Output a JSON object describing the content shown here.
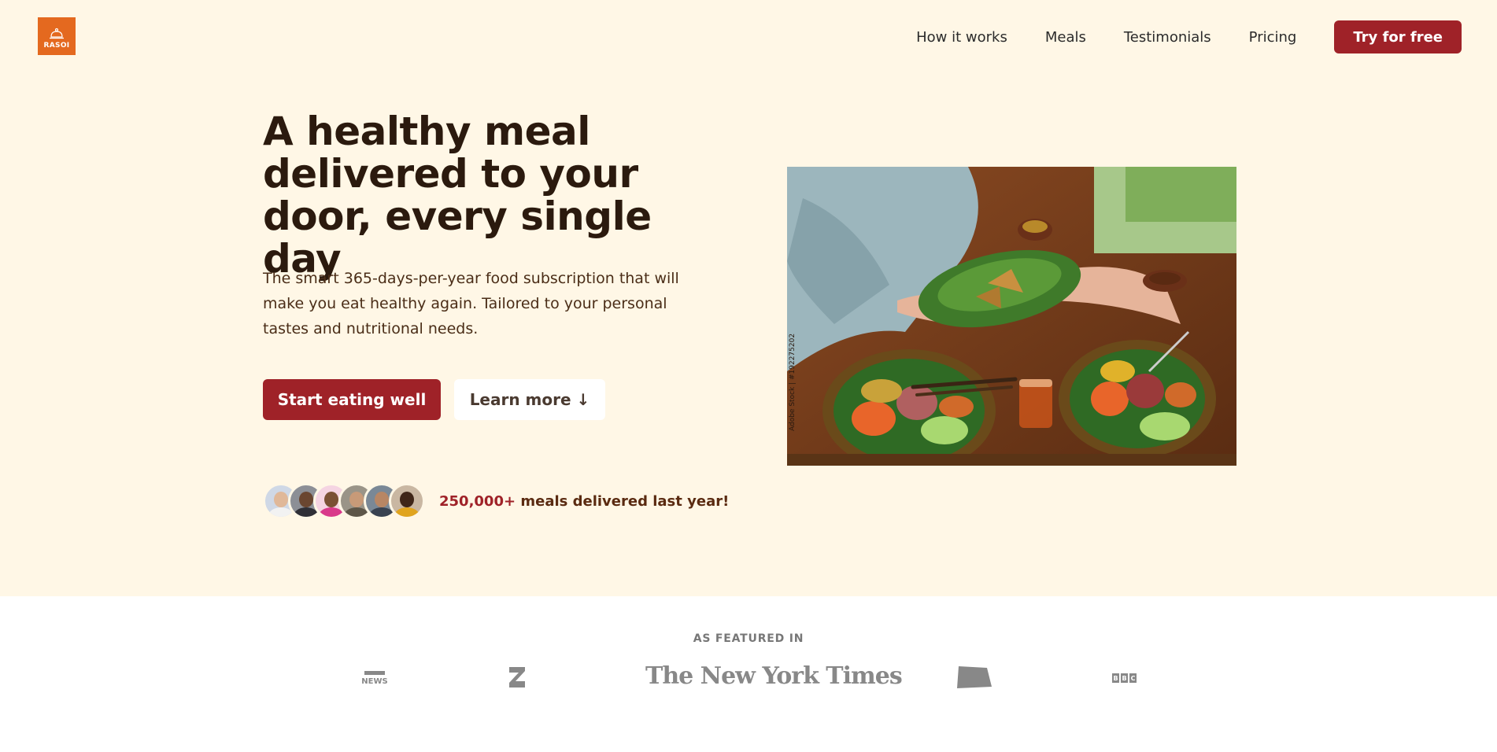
{
  "brand": {
    "name": "RASOI",
    "color": "#e4691f"
  },
  "nav": {
    "items": [
      "How it works",
      "Meals",
      "Testimonials",
      "Pricing"
    ],
    "cta": "Try for free"
  },
  "hero": {
    "title": "A healthy meal delivered to your door, every single day",
    "description": "The smart 365-days-per-year food subscription that will make you eat healthy again. Tailored to your personal tastes and nutritional needs.",
    "primary_button": "Start eating well",
    "secondary_button": "Learn more ↓",
    "delivered_count": "250,000+",
    "delivered_text": "meals delivered last year!",
    "image_credit": "Adobe Stock | #192275202"
  },
  "featured": {
    "title": "AS FEATURED IN",
    "logos": [
      "techcrunch-logo",
      "business-insider-logo",
      "The New York Times",
      "forbes-logo",
      "usa-today-logo"
    ]
  },
  "colors": {
    "accent": "#9f2228",
    "hero_bg": "#fff7e6",
    "heading": "#2b1a0e"
  }
}
